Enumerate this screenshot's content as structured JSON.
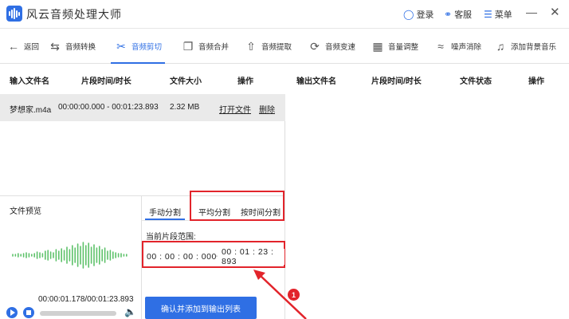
{
  "app": {
    "title": "风云音频处理大师"
  },
  "titlebar": {
    "login": "登录",
    "service": "客服",
    "menu": "菜单",
    "minimize": "—",
    "close": "✕"
  },
  "toolbar": {
    "items": [
      {
        "label": "返回",
        "icon": "back-arrow-icon"
      },
      {
        "label": "音频转换",
        "icon": "convert-icon"
      },
      {
        "label": "音频剪切",
        "icon": "scissors-icon"
      },
      {
        "label": "音频合并",
        "icon": "merge-icon"
      },
      {
        "label": "音频提取",
        "icon": "extract-icon"
      },
      {
        "label": "音频变速",
        "icon": "speed-icon"
      },
      {
        "label": "音量调整",
        "icon": "volume-bars-icon"
      },
      {
        "label": "噪声消除",
        "icon": "noise-icon"
      },
      {
        "label": "添加背景音乐",
        "icon": "music-note-icon"
      }
    ],
    "active_index": 2
  },
  "input_table": {
    "headers": [
      "输入文件名",
      "片段时间/时长",
      "文件大小",
      "操作"
    ],
    "rows": [
      {
        "name": "梦想家.m4a",
        "range": "00:00:00.000 - 00:01:23.893",
        "size": "2.32 MB",
        "open": "打开文件",
        "delete": "删除"
      }
    ]
  },
  "output_table": {
    "headers": [
      "输出文件名",
      "片段时间/时长",
      "文件状态",
      "操作"
    ]
  },
  "preview": {
    "title": "文件预览",
    "time": "00:00:01.178/00:01:23.893"
  },
  "split": {
    "tabs": [
      "手动分割",
      "平均分割",
      "按时间分割"
    ],
    "active_tab": 0,
    "range_label": "当前片段范围:",
    "start": "00 : 00 : 00 : 000",
    "separator": "-",
    "end": "00 : 01 : 23 : 893",
    "confirm": "确认并添加到输出列表"
  },
  "annotation": {
    "number": "1",
    "color": "#e2242b"
  },
  "colors": {
    "accent": "#2f6fe4",
    "highlight": "#e2242b"
  }
}
